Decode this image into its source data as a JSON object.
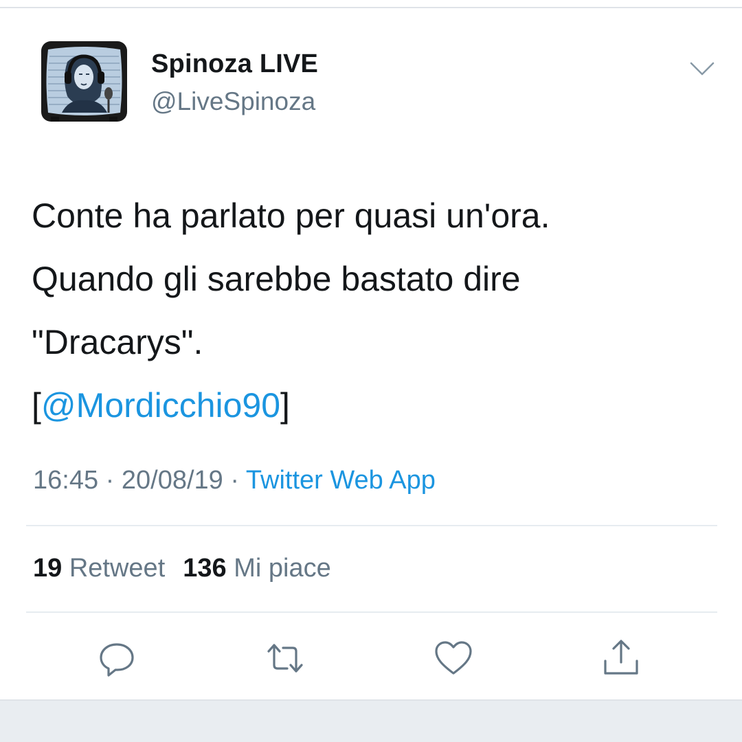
{
  "author": {
    "name": "Spinoza LIVE",
    "handle": "@LiveSpinoza"
  },
  "tweet": {
    "line1": "Conte ha parlato per quasi un'ora.",
    "line2": "Quando gli sarebbe bastato dire",
    "line3": "\"Dracarys\".",
    "mention_open": "[",
    "mention": "@Mordicchio90",
    "mention_close": "]"
  },
  "meta": {
    "time": "16:45",
    "separator1": " · ",
    "date": "20/08/19",
    "separator2": " · ",
    "source": "Twitter Web App"
  },
  "stats": {
    "retweet_count": "19",
    "retweet_label": "Retweet",
    "like_count": "136",
    "like_label": "Mi piace"
  },
  "icons": {
    "menu": "chevron-down-icon",
    "reply": "reply-icon",
    "retweet": "retweet-icon",
    "like": "heart-icon",
    "share": "share-icon"
  },
  "colors": {
    "text": "#14171a",
    "secondary": "#657786",
    "link": "#1b95e0",
    "icon": "#657786"
  }
}
